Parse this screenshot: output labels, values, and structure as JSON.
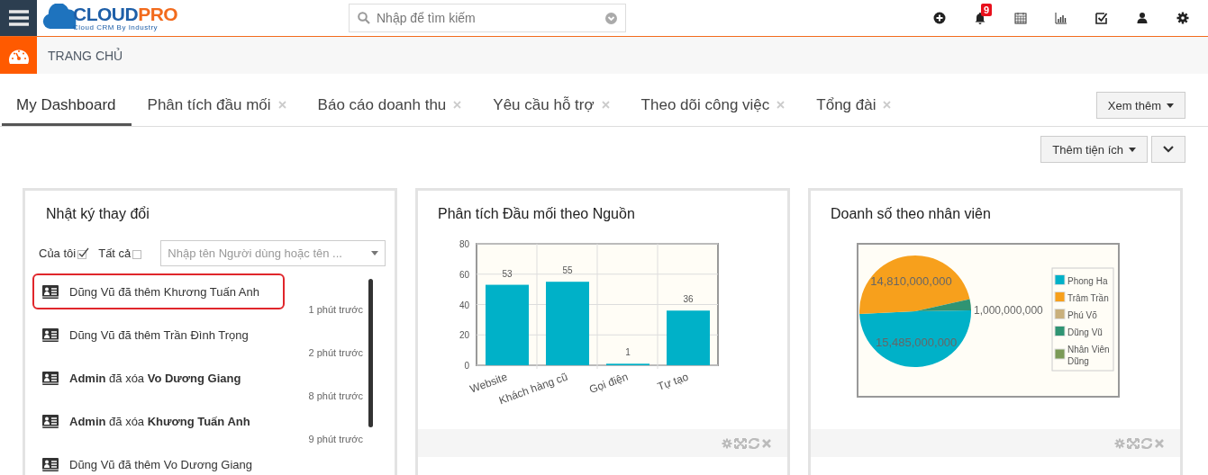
{
  "header": {
    "logo": {
      "brand_main": "CLOUD",
      "brand_accent": "PRO",
      "tagline": "Cloud CRM By Industry"
    },
    "search": {
      "placeholder": "Nhập để tìm kiếm"
    },
    "notification_count": "9"
  },
  "breadcrumb": {
    "title": "TRANG CHỦ"
  },
  "tabs": [
    {
      "label": "My Dashboard",
      "selected": true,
      "closable": false
    },
    {
      "label": "Phân tích đầu mối",
      "selected": false,
      "closable": true
    },
    {
      "label": "Báo cáo doanh thu",
      "selected": false,
      "closable": true
    },
    {
      "label": "Yêu cầu hỗ trợ",
      "selected": false,
      "closable": true
    },
    {
      "label": "Theo dõi công việc",
      "selected": false,
      "closable": true
    },
    {
      "label": "Tổng đài",
      "selected": false,
      "closable": true
    }
  ],
  "more_tabs_button": "Xem thêm",
  "add_widget_button": "Thêm tiện ích",
  "widgets": [
    {
      "kind": "activity",
      "title": "Nhật ký thay đổi",
      "filters": [
        {
          "label": "Của tôi",
          "checked": true
        },
        {
          "label": "Tất cả",
          "checked": false
        }
      ],
      "user_search": {
        "placeholder": "Nhập tên Người dùng hoặc tên ..."
      },
      "items": [
        {
          "text": "Dũng Vũ đã thêm Khương Tuấn Anh",
          "time": "1 phút trước",
          "highlighted": true
        },
        {
          "text": "Dũng Vũ đã thêm Trần Đình Trọng",
          "time": "2 phút trước",
          "highlighted": false
        },
        {
          "text": "**Admin** đã xóa **Vo Dương Giang**",
          "time": "8 phút trước",
          "highlighted": false
        },
        {
          "text": "**Admin** đã xóa **Khương Tuấn Anh**",
          "time": "9 phút trước",
          "highlighted": false
        },
        {
          "text": "Dũng Vũ đã thêm Vo Dương Giang",
          "highlighted": false
        }
      ]
    },
    {
      "kind": "chart",
      "title": "Phân tích Đầu mối theo Nguồn",
      "chart_data": {
        "type": "bar",
        "categories": [
          "Website",
          "Khách hàng cũ",
          "Gọi điện",
          "Tự tạo"
        ],
        "color": "#00b1c8",
        "values": [
          53,
          55,
          1,
          36
        ],
        "ylim": [
          0,
          80
        ],
        "yticks": [
          0,
          20,
          40,
          60,
          80
        ],
        "grid": true,
        "data_labels": true
      }
    },
    {
      "kind": "chart",
      "title": "Doanh số theo nhân viên",
      "chart_data": {
        "type": "pie",
        "categories": [
          "Phong Ha",
          "Trâm Trần",
          "Phú Võ",
          "Dũng Vũ",
          "Nhân Viên Dũng"
        ],
        "colors": [
          "#00b1c8",
          "#f7a01c",
          "#c9b07c",
          "#2f9473",
          "#7a9a57"
        ],
        "values": [
          15485000000,
          14810000000,
          0,
          1000000000,
          0
        ],
        "value_labels": [
          "15,485,000,000",
          "14,810,000,000",
          null,
          "1,000,000,000",
          null
        ],
        "legend": true
      }
    }
  ]
}
